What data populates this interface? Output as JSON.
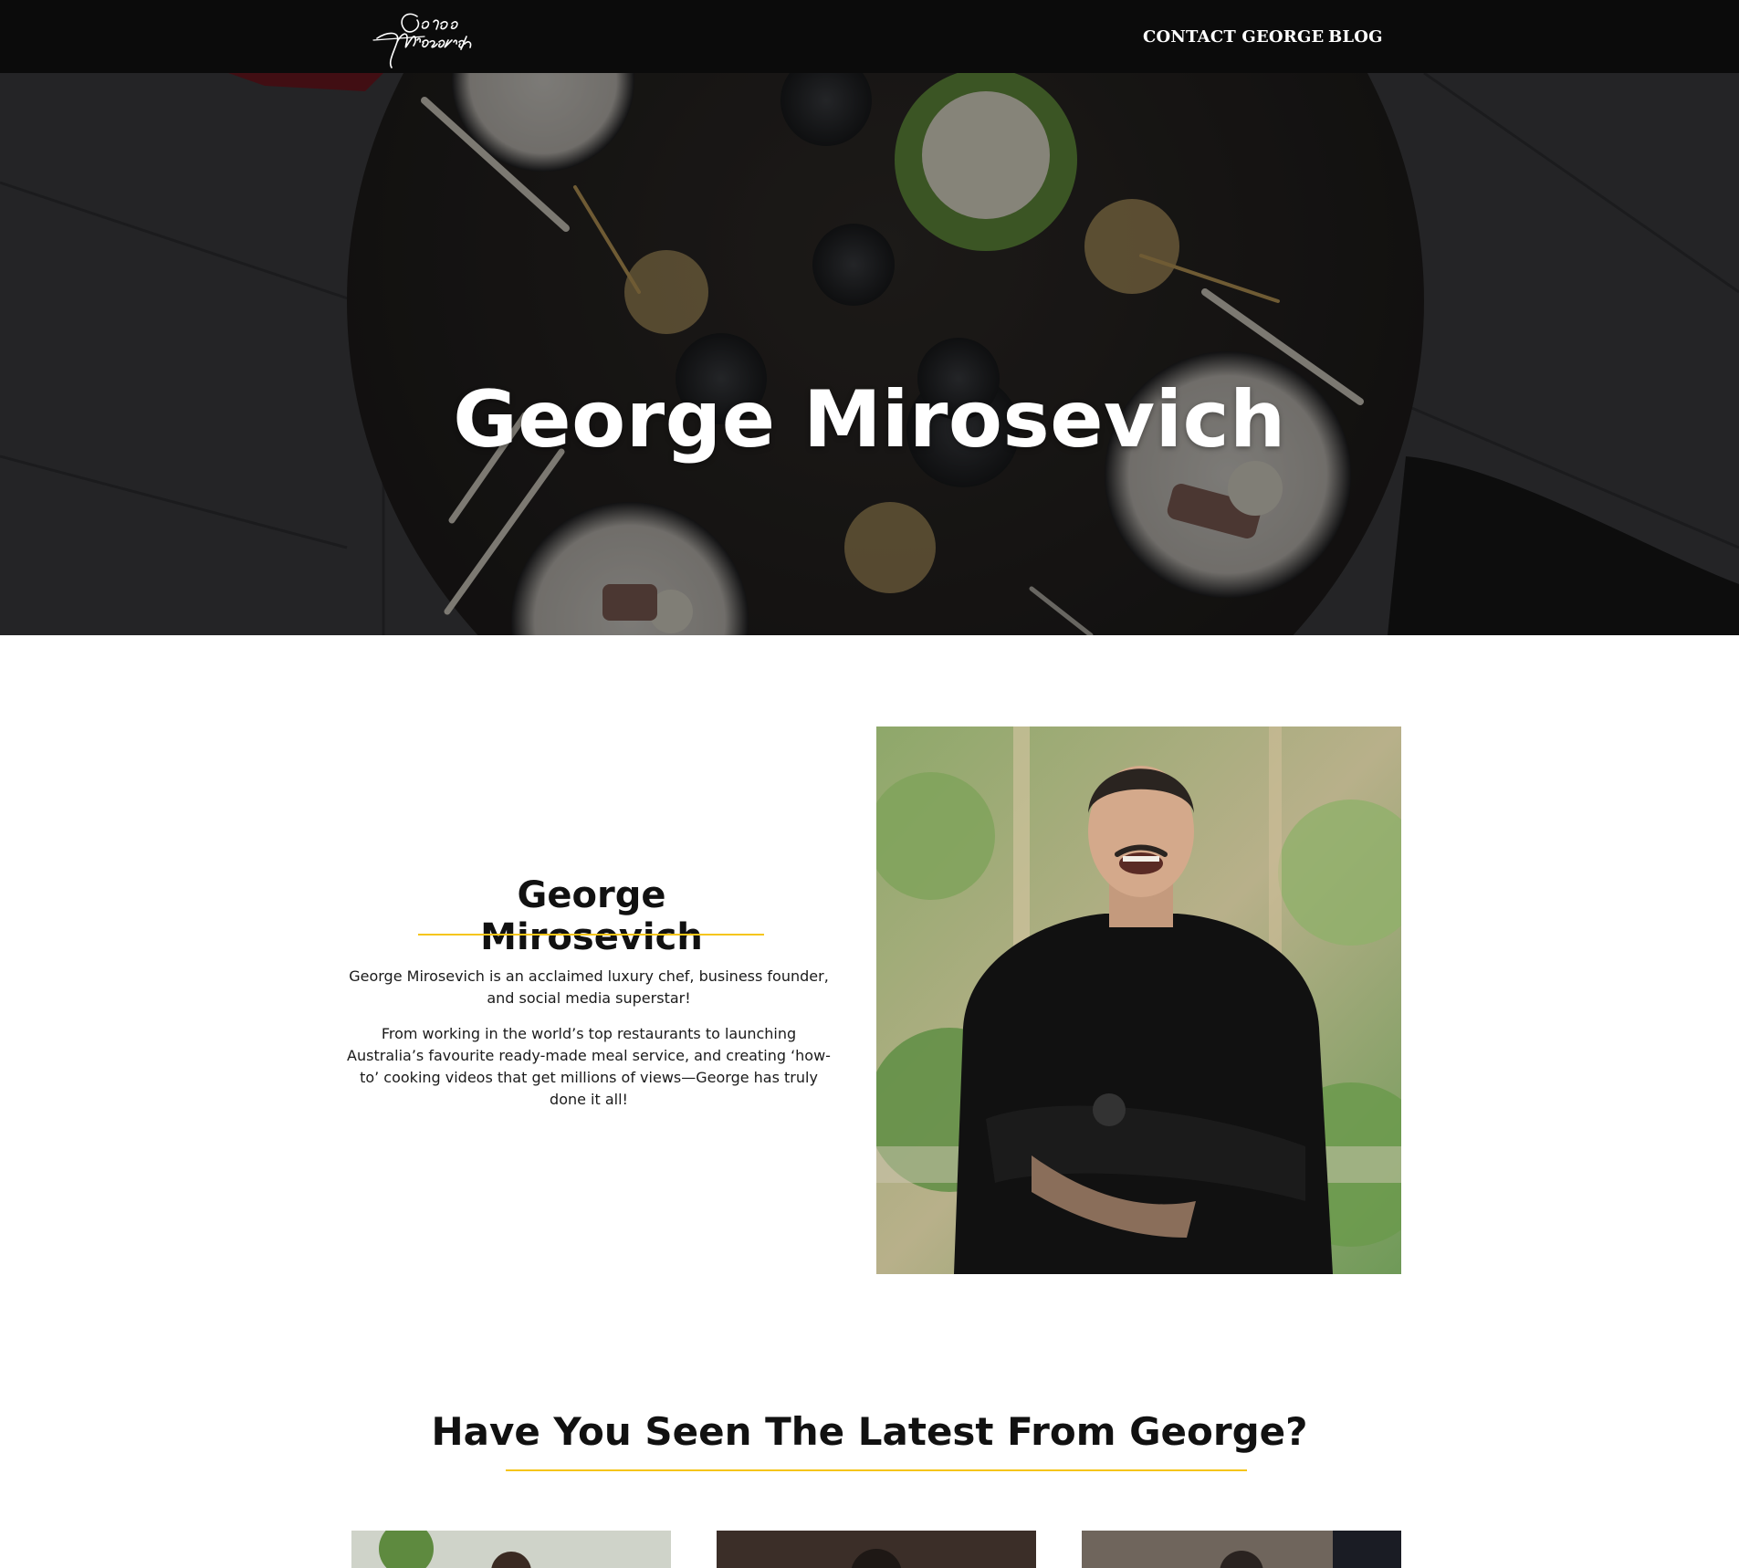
{
  "header": {
    "logo_text": "George Mirosevich",
    "nav": [
      {
        "label": "CONTACT GEORGE"
      },
      {
        "label": "BLOG"
      }
    ]
  },
  "hero": {
    "title": "George Mirosevich",
    "image": "overhead-dinner-table-photo"
  },
  "about": {
    "heading": "George Mirosevich",
    "paragraphs": [
      "George Mirosevich is an acclaimed luxury chef, business founder, and social media superstar!",
      "From working in the world’s top restaurants to launching Australia’s favourite ready-made meal service, and creating ‘how-to’ cooking videos that get millions of views—George has truly done it all!"
    ],
    "portrait": "george-portrait-photo"
  },
  "latest": {
    "heading": "Have You Seen The Latest From George?",
    "cards": [
      {
        "image": "latest-post-1-thumbnail"
      },
      {
        "image": "latest-post-2-thumbnail"
      },
      {
        "image": "latest-post-3-thumbnail"
      }
    ]
  },
  "colors": {
    "accent": "#f5c518",
    "header_bg": "#0b0b0b"
  }
}
